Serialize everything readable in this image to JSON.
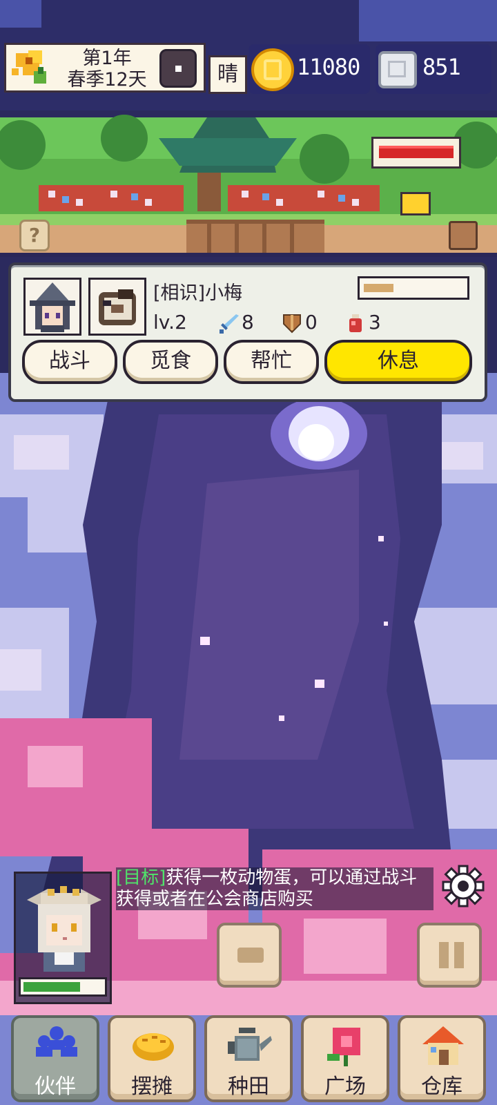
{
  "status_bar": {
    "year": "第1年",
    "season_day": "春季12天",
    "weather": "晴",
    "coins": "11080",
    "gems": "851",
    "icons": [
      "flower-icon",
      "clock-icon",
      "coin-icon",
      "gem-icon"
    ]
  },
  "scene": {
    "help_label": "?",
    "health_level": 1.0
  },
  "partner": {
    "name": "[相识]小梅",
    "level": "lv.2",
    "attack": "8",
    "defense": "0",
    "hp": "3",
    "affinity_level": 0.3,
    "actions": {
      "fight": "战斗",
      "forage": "觅食",
      "help": "帮忙",
      "rest": "休息"
    }
  },
  "goal": {
    "tag": "[目标]",
    "text": "获得一枚动物蛋，可以通过战斗获得或者在公会商店购买"
  },
  "avatar": {
    "hp_level": 0.72
  },
  "nav": {
    "partner": "伙伴",
    "stall": "摆摊",
    "farm": "种田",
    "square": "广场",
    "warehouse": "仓库"
  },
  "colors": {
    "accent_yellow": "#ffe600",
    "goal_green": "#4fe46a",
    "health_red": "#d62828",
    "panel_bg": "#eef0e8"
  }
}
